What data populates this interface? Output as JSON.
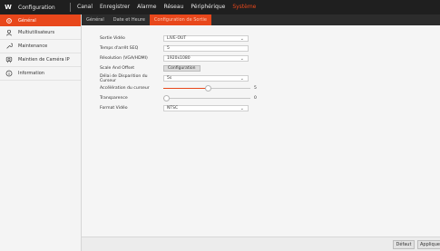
{
  "topbar": {
    "logo": "W",
    "app_title": "Configuration",
    "menu": [
      "Canal",
      "Enregistrer",
      "Alarme",
      "Réseau",
      "Périphérique",
      "Système"
    ],
    "active_menu": "Système"
  },
  "sidebar": {
    "items": [
      {
        "label": "Général",
        "icon": "gear-icon",
        "active": true
      },
      {
        "label": "Multiutilisateurs",
        "icon": "user-icon",
        "active": false
      },
      {
        "label": "Maintenance",
        "icon": "wrench-icon",
        "active": false
      },
      {
        "label": "Maintien de Caméra IP",
        "icon": "camera-icon",
        "active": false
      },
      {
        "label": "Information",
        "icon": "info-icon",
        "active": false
      }
    ]
  },
  "subtabs": [
    {
      "label": "Général",
      "active": false
    },
    {
      "label": "Date et Heure",
      "active": false
    },
    {
      "label": "Configuration de Sortie",
      "active": true
    }
  ],
  "form": {
    "sortie_video": {
      "label": "Sortie Vidéo",
      "value": "LIVE-OUT"
    },
    "temps_arret": {
      "label": "Temps d'arrêt SEQ",
      "value": "5"
    },
    "resolution": {
      "label": "Résolution (VGA/HDMI)",
      "value": "1920x1080"
    },
    "scale": {
      "label": "Scale And Offset",
      "button": "Configuration"
    },
    "delai": {
      "label": "Délai de Disparition du Curseur",
      "value": "5s"
    },
    "acceleration": {
      "label": "Accélération du curseur",
      "value": "5",
      "fraction": 0.52
    },
    "transparence": {
      "label": "Transparence",
      "value": "0",
      "fraction": 0.0
    },
    "format_video": {
      "label": "Format Vidéo",
      "value": "NTSC"
    }
  },
  "footer": {
    "default_label": "Défaut",
    "apply_label": "Appliquer"
  },
  "colors": {
    "accent": "#e8471b",
    "topbar_bg": "#1f1f1f",
    "subtab_bg": "#2c2c2c"
  }
}
